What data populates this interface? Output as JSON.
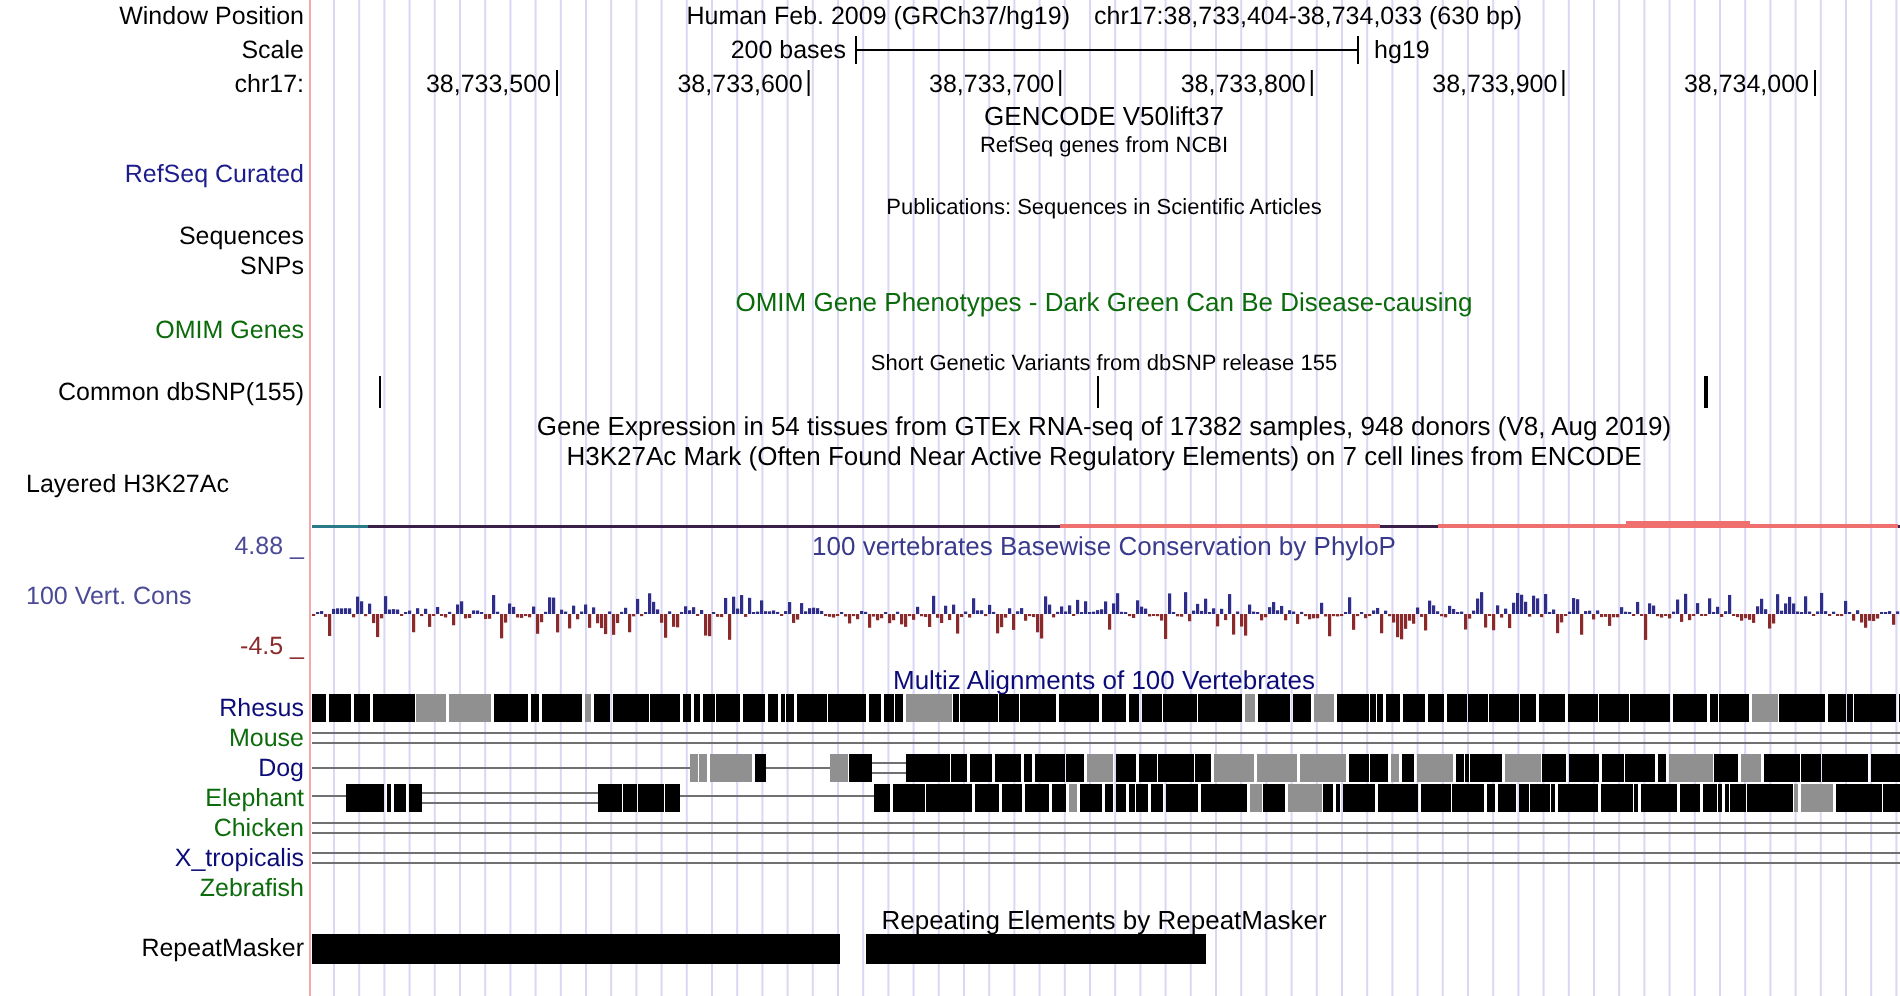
{
  "header": {
    "assembly": "Human Feb. 2009 (GRCh37/hg19)",
    "position": "chr17:38,733,404-38,734,033 (630 bp)",
    "scale_length": "200 bases",
    "scale_db": "hg19",
    "ticks": [
      "38,733,500",
      "38,733,600",
      "38,733,700",
      "38,733,800",
      "38,733,900",
      "38,734,000"
    ]
  },
  "left_labels": [
    {
      "text": "Window Position",
      "color": "#000000"
    },
    {
      "text": "Scale",
      "color": "#000000"
    },
    {
      "text": "chr17:",
      "color": "#000000"
    },
    {
      "text": "RefSeq Curated",
      "color": "#1c1c8c"
    },
    {
      "text": "Sequences",
      "color": "#000000"
    },
    {
      "text": "SNPs",
      "color": "#000000"
    },
    {
      "text": "OMIM Genes",
      "color": "#0b6b0b"
    },
    {
      "text": "Common dbSNP(155)",
      "color": "#000000"
    },
    {
      "text": "Layered H3K27Ac",
      "color": "#000000"
    },
    {
      "text": "4.88 _",
      "color": "#4a4a96"
    },
    {
      "text": "100 Vert. Cons",
      "color": "#4a4a96"
    },
    {
      "text": "-4.5 _",
      "color": "#8b2a2a"
    },
    {
      "text": "Rhesus",
      "color": "#0c0c78"
    },
    {
      "text": "Mouse",
      "color": "#0c6c0c"
    },
    {
      "text": "Dog",
      "color": "#0c0c78"
    },
    {
      "text": "Elephant",
      "color": "#0c6c0c"
    },
    {
      "text": "Chicken",
      "color": "#0c6c0c"
    },
    {
      "text": "X_tropicalis",
      "color": "#0c0c78"
    },
    {
      "text": "Zebrafish",
      "color": "#0c6c0c"
    },
    {
      "text": "RepeatMasker",
      "color": "#000000"
    }
  ],
  "track_titles": [
    {
      "text": "GENCODE V50lift37",
      "color": "#000000"
    },
    {
      "text": "RefSeq genes from NCBI",
      "color": "#000000"
    },
    {
      "text": "Publications: Sequences in Scientific Articles",
      "color": "#000000"
    },
    {
      "text": "OMIM Gene Phenotypes - Dark Green Can Be Disease-causing",
      "color": "#0b6b0b"
    },
    {
      "text": "Short Genetic Variants from dbSNP release 155",
      "color": "#000000"
    },
    {
      "text": "Gene Expression in 54 tissues from GTEx RNA-seq of 17382 samples, 948 donors (V8, Aug 2019)",
      "color": "#000000"
    },
    {
      "text": "H3K27Ac Mark (Often Found Near Active Regulatory Elements) on 7 cell lines from ENCODE",
      "color": "#000000"
    },
    {
      "text": "100 vertebrates Basewise Conservation by PhyloP",
      "color": "#3a3a8c"
    },
    {
      "text": "Multiz Alignments of 100 Vertebrates",
      "color": "#0c0c78"
    },
    {
      "text": "Repeating Elements by RepeatMasker",
      "color": "#000000"
    }
  ]
}
